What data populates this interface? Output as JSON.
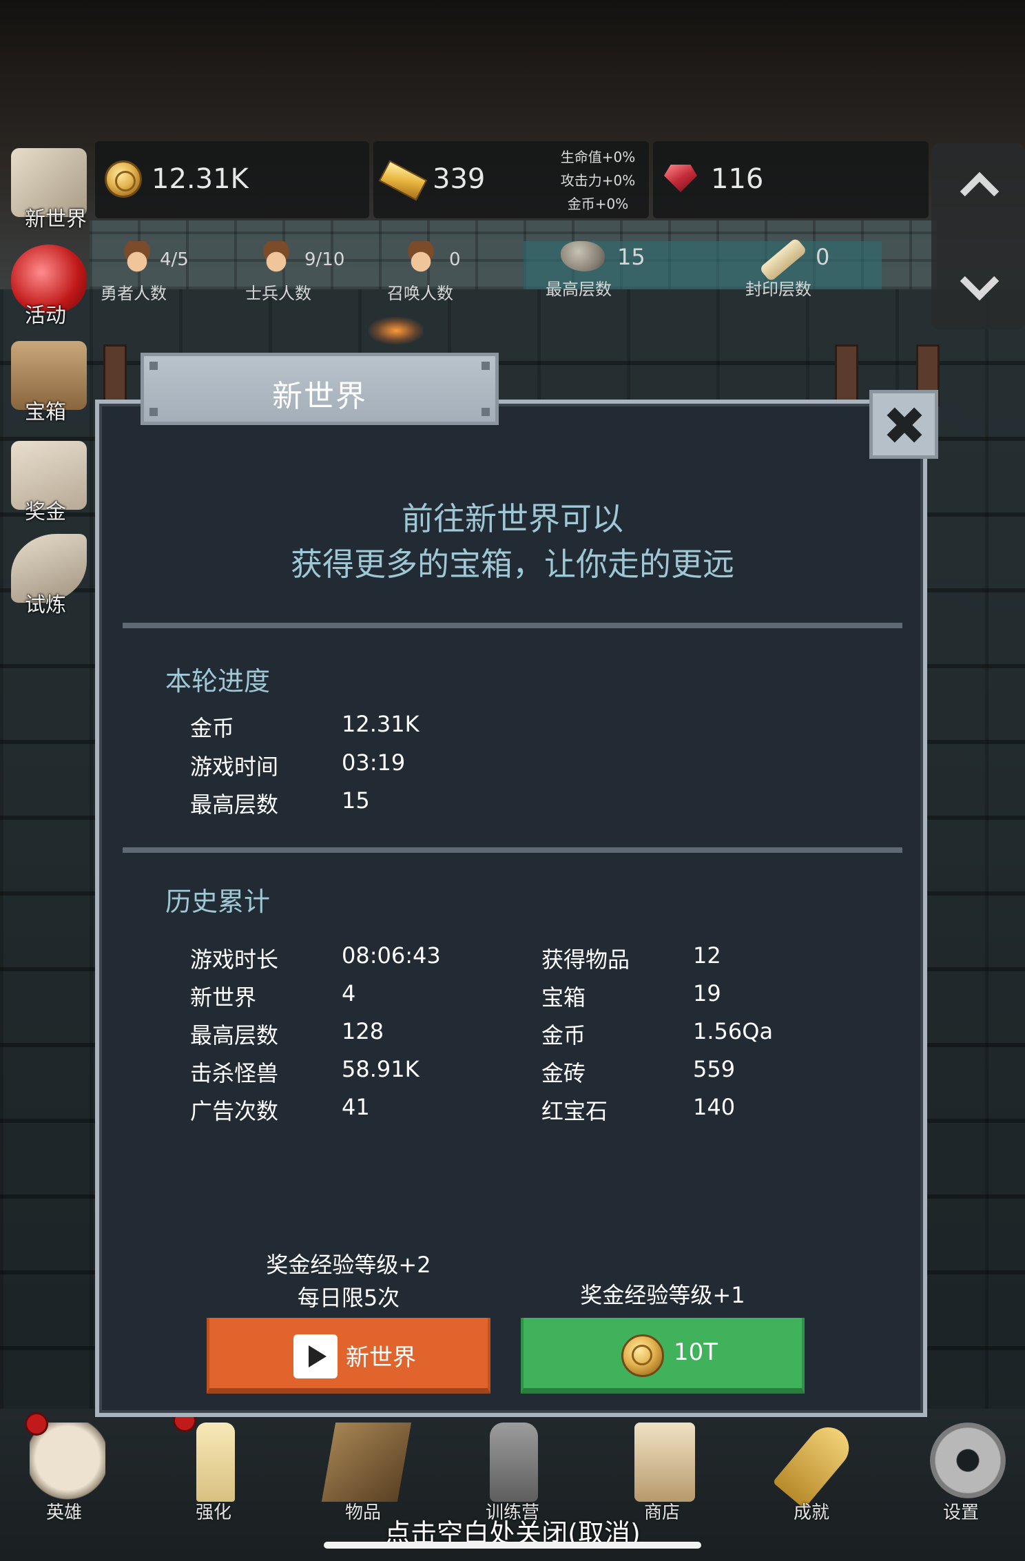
{
  "resources": {
    "coins": "12.31K",
    "gold_bars": "339",
    "rubies": "116",
    "bonus": [
      "生命值+0%",
      "攻击力+0%",
      "金币+0%"
    ]
  },
  "stats": [
    {
      "value": "4/5",
      "label": "勇者人数"
    },
    {
      "value": "9/10",
      "label": "士兵人数"
    },
    {
      "value": "0",
      "label": "召唤人数"
    },
    {
      "value": "15",
      "label": "最高层数"
    },
    {
      "value": "0",
      "label": "封印层数"
    }
  ],
  "side_menu": [
    "新世界",
    "活动",
    "宝箱",
    "奖金",
    "试炼"
  ],
  "dialog": {
    "title": "新世界",
    "intro_line1": "前往新世界可以",
    "intro_line2": "获得更多的宝箱，让你走的更远",
    "current_section": {
      "title": "本轮进度",
      "rows": [
        {
          "label": "金币",
          "value": "12.31K"
        },
        {
          "label": "游戏时间",
          "value": "03:19"
        },
        {
          "label": "最高层数",
          "value": "15"
        }
      ]
    },
    "history_section": {
      "title": "历史累计",
      "left": [
        {
          "label": "游戏时长",
          "value": "08:06:43"
        },
        {
          "label": "新世界",
          "value": "4"
        },
        {
          "label": "最高层数",
          "value": "128"
        },
        {
          "label": "击杀怪兽",
          "value": "58.91K"
        },
        {
          "label": "广告次数",
          "value": "41"
        }
      ],
      "right": [
        {
          "label": "获得物品",
          "value": "12"
        },
        {
          "label": "宝箱",
          "value": "19"
        },
        {
          "label": "金币",
          "value": "1.56Qa"
        },
        {
          "label": "金砖",
          "value": "559"
        },
        {
          "label": "红宝石",
          "value": "140"
        }
      ]
    },
    "ad_option": {
      "reward_line1": "奖金经验等级+2",
      "reward_line2": "每日限5次",
      "button_label": "新世界"
    },
    "coin_option": {
      "reward_line1": "奖金经验等级+1",
      "button_label": "10T"
    }
  },
  "bottom_nav": [
    "英雄",
    "强化",
    "物品",
    "训练营",
    "商店",
    "成就",
    "设置"
  ],
  "close_hint": "点击空白处关闭(取消)",
  "colors": {
    "dialog_bg": "#222b33",
    "accent_text": "#9ec8d6",
    "button_orange": "#e0642c",
    "button_green": "#3fb25b"
  }
}
